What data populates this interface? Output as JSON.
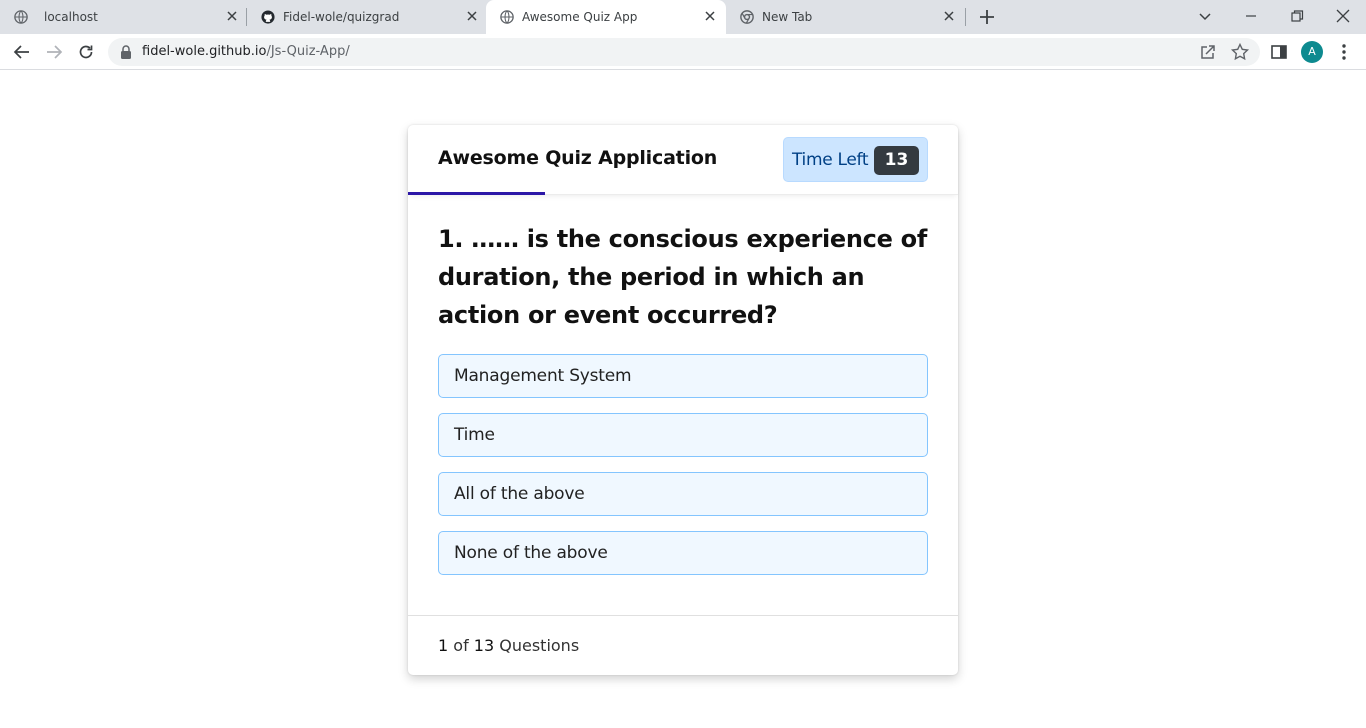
{
  "browser": {
    "tabs": [
      {
        "title": "localhost",
        "icon": "globe-icon",
        "active": false
      },
      {
        "title": "Fidel-wole/quizgrad",
        "icon": "github-icon",
        "active": false
      },
      {
        "title": "Awesome Quiz App",
        "icon": "globe-icon",
        "active": true
      },
      {
        "title": "New Tab",
        "icon": "chrome-icon",
        "active": false
      }
    ],
    "url_host": "fidel-wole.github.io",
    "url_path": "/Js-Quiz-App/",
    "profile_initial": "A",
    "profile_color": "#0d8a8f"
  },
  "quiz": {
    "title": "Awesome Quiz Application",
    "timer_label": "Time Left",
    "timer_seconds": "13",
    "question": "1. …… is the conscious experience of duration, the period in which an action or event occurred?",
    "options": [
      "Management System",
      "Time",
      "All of the above",
      "None of the above"
    ],
    "footer": {
      "current": "1",
      "of": "of",
      "total": "13",
      "suffix": "Questions"
    },
    "accent_color": "#2c17a7",
    "option_bg": "#f0f8ff",
    "option_border": "#84c5fe"
  }
}
